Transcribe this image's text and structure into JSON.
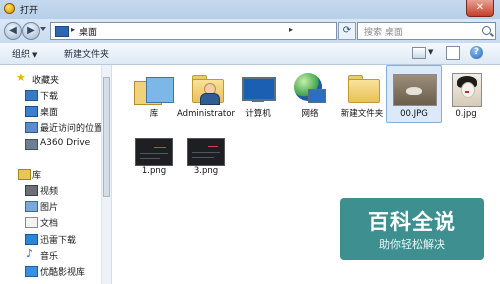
{
  "window": {
    "title": "打开",
    "close_glyph": "✕"
  },
  "nav": {
    "back_glyph": "◀",
    "forward_glyph": "▶",
    "refresh_glyph": "⟳",
    "address": {
      "arrow": "▸",
      "location": "桌面",
      "separator": "▸"
    },
    "search_placeholder": "搜索 桌面"
  },
  "toolbar": {
    "organize": "组织",
    "organize_caret": "▼",
    "new_folder": "新建文件夹",
    "views_caret": "▼",
    "help_glyph": "?"
  },
  "sidebar": {
    "favorites_header": "收藏夹",
    "favorites": [
      "下载",
      "桌面",
      "最近访问的位置",
      "A360 Drive"
    ],
    "libraries_header": "库",
    "libraries": [
      "视频",
      "图片",
      "文档",
      "迅雷下载",
      "音乐",
      "优酷影视库"
    ]
  },
  "files": [
    {
      "name": "库",
      "icon": "library-icon"
    },
    {
      "name": "Administrator",
      "icon": "user-folder-icon"
    },
    {
      "name": "计算机",
      "icon": "computer-icon"
    },
    {
      "name": "网络",
      "icon": "network-icon"
    },
    {
      "name": "新建文件夹",
      "icon": "folder-icon"
    },
    {
      "name": "00.JPG",
      "icon": "image-thumbnail",
      "selected": true
    },
    {
      "name": "0.jpg",
      "icon": "image-thumbnail"
    },
    {
      "name": "1.png",
      "icon": "image-thumbnail"
    },
    {
      "name": "3.png",
      "icon": "image-thumbnail"
    }
  ],
  "watermark": {
    "title": "百科全说",
    "subtitle": "助你轻松解决"
  },
  "colors": {
    "selection": "#dbe9fa",
    "watermark_bg": "#147878"
  }
}
